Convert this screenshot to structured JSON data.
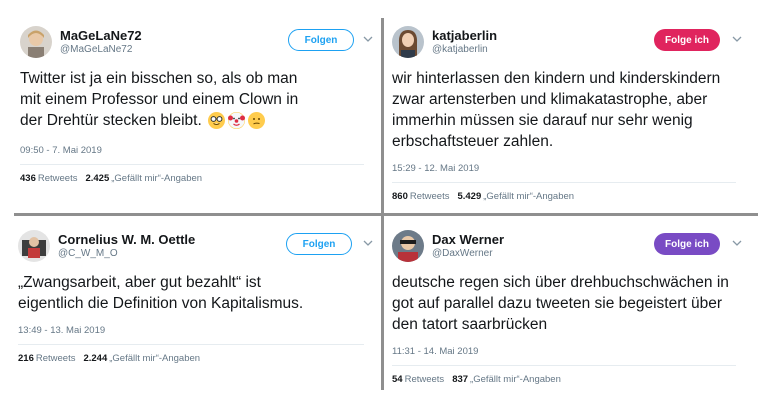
{
  "tweets": [
    {
      "display_name": "MaGeLaNe72",
      "handle": "@MaGeLaNe72",
      "follow_label": "Folgen",
      "text": "Twitter ist ja ein bisschen so, als ob man mit einem Professor und einem Clown in der Drehtür stecken bleibt.",
      "emojis": [
        "nerd-face-icon",
        "clown-face-icon",
        "confused-face-icon"
      ],
      "timestamp": "09:50 - 7. Mai 2019",
      "retweets": "436",
      "retweets_label": "Retweets",
      "likes": "2.425",
      "likes_label": "„Gefällt mir“-Angaben"
    },
    {
      "display_name": "katjaberlin",
      "handle": "@katjaberlin",
      "follow_label": "Folge ich",
      "text": "wir hinterlassen den kindern und kinderskindern zwar artensterben und klimakatastrophe, aber immerhin müssen sie darauf nur sehr wenig erbschaftsteuer zahlen.",
      "timestamp": "15:29 - 12. Mai 2019",
      "retweets": "860",
      "retweets_label": "Retweets",
      "likes": "5.429",
      "likes_label": "„Gefällt mir“-Angaben"
    },
    {
      "display_name": "Cornelius W. M. Oettle",
      "handle": "@C_W_M_O",
      "follow_label": "Folgen",
      "text": "„Zwangsarbeit, aber gut bezahlt“ ist eigentlich die Definition von Kapitalismus.",
      "timestamp": "13:49 - 13. Mai 2019",
      "retweets": "216",
      "retweets_label": "Retweets",
      "likes": "2.244",
      "likes_label": "„Gefällt mir“-Angaben"
    },
    {
      "display_name": "Dax Werner",
      "handle": "@DaxWerner",
      "follow_label": "Folge ich",
      "text": "deutsche regen sich über drehbuchschwächen in got auf parallel dazu tweeten sie begeistert über den tatort saarbrücken",
      "timestamp": "11:31 - 14. Mai 2019",
      "retweets": "54",
      "retweets_label": "Retweets",
      "likes": "837",
      "likes_label": "„Gefällt mir“-Angaben"
    }
  ],
  "colors": {
    "follow_outline": "#1da1f2",
    "following_red": "#e0245e",
    "following_purple": "#794bc4",
    "divider": "#8f8f8f",
    "meta_text": "#657786"
  }
}
